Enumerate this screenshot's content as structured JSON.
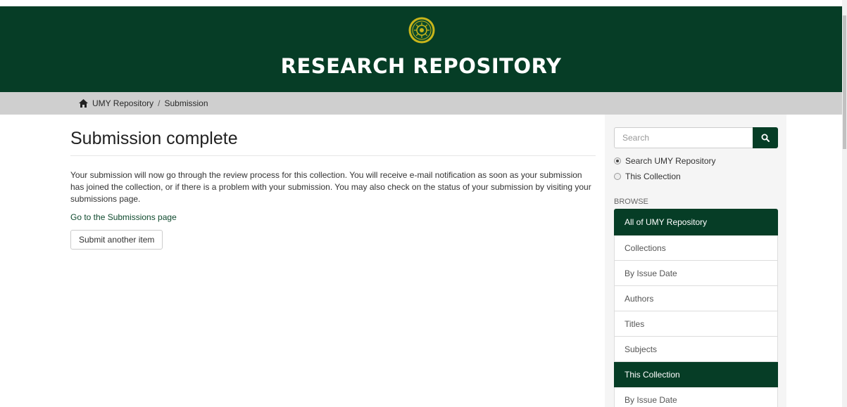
{
  "header": {
    "logo": "umy-seal-logo",
    "title": "RESEARCH REPOSITORY",
    "bg_color": "#063d26"
  },
  "breadcrumb": {
    "home_icon": "home-icon",
    "items": [
      "UMY Repository",
      "Submission"
    ],
    "separator": "/"
  },
  "main": {
    "title": "Submission complete",
    "message": "Your submission will now go through the review process for this collection. You will receive e-mail notification as soon as your submission has joined the collection, or if there is a problem with your submission. You may also check on the status of your submission by visiting your submissions page.",
    "submissions_link": "Go to the Submissions page",
    "submit_another_label": "Submit another item"
  },
  "sidebar": {
    "search": {
      "placeholder": "Search",
      "button_icon": "search-icon",
      "scope_options": [
        {
          "label": "Search UMY Repository",
          "checked": true
        },
        {
          "label": "This Collection",
          "checked": false
        }
      ]
    },
    "browse": {
      "heading": "BROWSE",
      "sections": [
        {
          "title": "All of UMY Repository",
          "items": [
            "Collections",
            "By Issue Date",
            "Authors",
            "Titles",
            "Subjects"
          ]
        },
        {
          "title": "This Collection",
          "items": [
            "By Issue Date"
          ]
        }
      ]
    }
  }
}
